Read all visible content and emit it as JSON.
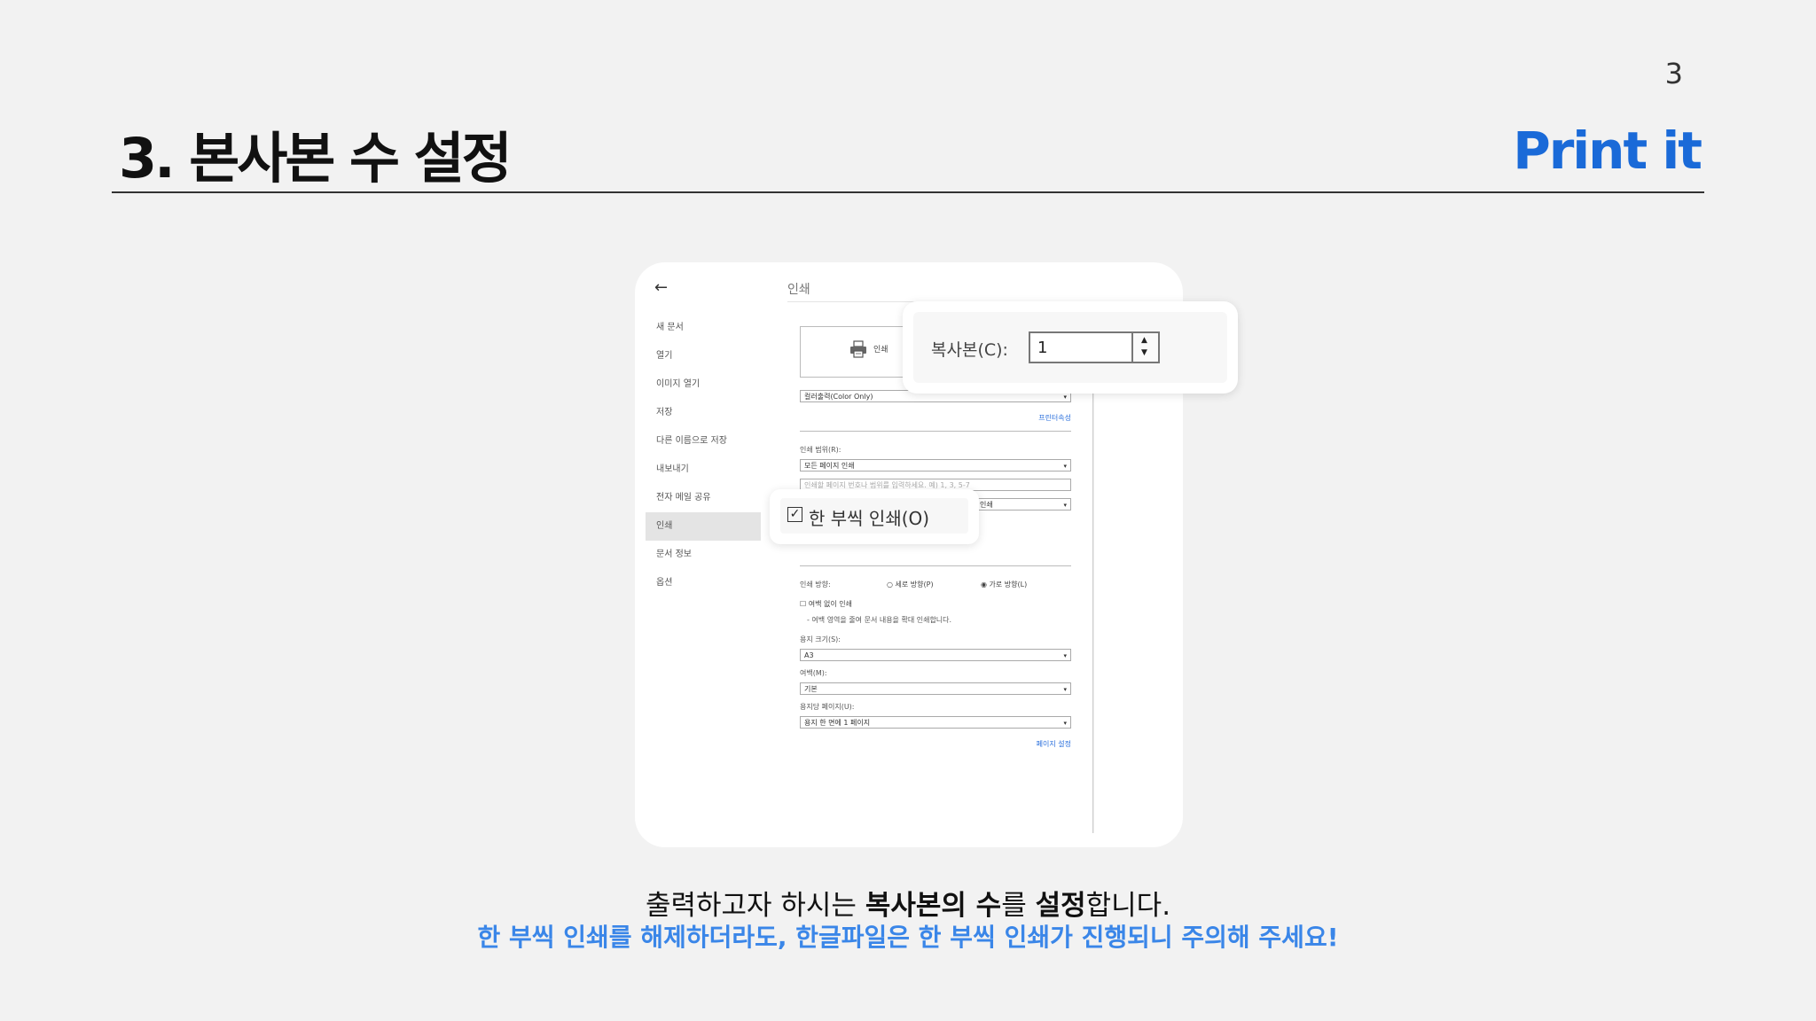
{
  "slide": {
    "page_number": "3",
    "title": "3. 본사본 수 설정",
    "brand": "Print it",
    "caption_normal_1": "출력하고자 하시는 ",
    "caption_bold_1": "복사본의 수",
    "caption_normal_2": "를 ",
    "caption_bold_2": "설정",
    "caption_normal_3": "합니다.",
    "warning": "한 부씩 인쇄를 해제하더라도, 한글파일은 한 부씩 인쇄가 진행되니 주의해 주세요!"
  },
  "dialog": {
    "back_icon": "←",
    "menu": [
      {
        "label": "새 문서"
      },
      {
        "label": "열기"
      },
      {
        "label": "이미지 열기"
      },
      {
        "label": "저장"
      },
      {
        "label": "다른 이름으로 저장"
      },
      {
        "label": "내보내기"
      },
      {
        "label": "전자 메일 공유"
      },
      {
        "label": "인쇄"
      },
      {
        "label": "문서 정보"
      },
      {
        "label": "옵션"
      }
    ],
    "heading": "인쇄",
    "print_button": "인쇄",
    "printer_select": "컬러출력(Color Only)",
    "printer_props_link": "프린터속성",
    "range_label": "인쇄 범위(R):",
    "range_select": "모든 페이지 인쇄",
    "range_input_placeholder": "인쇄할 페이지 번호나 범위를 입력하세요. 예) 1, 3, 5-7",
    "third_select_visible": "인쇄",
    "orientation_label": "인쇄 방향:",
    "portrait": "세로 방향(P)",
    "landscape": "가로 방향(L)",
    "borderless": "여백 없이 인쇄",
    "borderless_note": "- 여백 영역을 줄여 문서 내용을 확대 인쇄합니다.",
    "paper_size_label": "용지 크기(S):",
    "paper_size": "A3",
    "margin_label": "여백(M):",
    "margin": "기본",
    "pages_per_sheet_label": "용지당 페이지(U):",
    "pages_per_sheet": "용지 한 면에 1 페이지",
    "page_setup_link": "페이지 설정"
  },
  "callouts": {
    "copies_label": "복사본(C):",
    "copies_value": "1",
    "collate_label": "한 부씩 인쇄(O)"
  },
  "icons": {
    "back": "arrow-left-icon",
    "printer": "printer-icon",
    "spin_up": "▲",
    "spin_down": "▼",
    "check": "✓",
    "caret": "▾"
  },
  "colors": {
    "brand": "#1a6ad8",
    "warning": "#3a86e8",
    "background": "#f2f2f2"
  }
}
